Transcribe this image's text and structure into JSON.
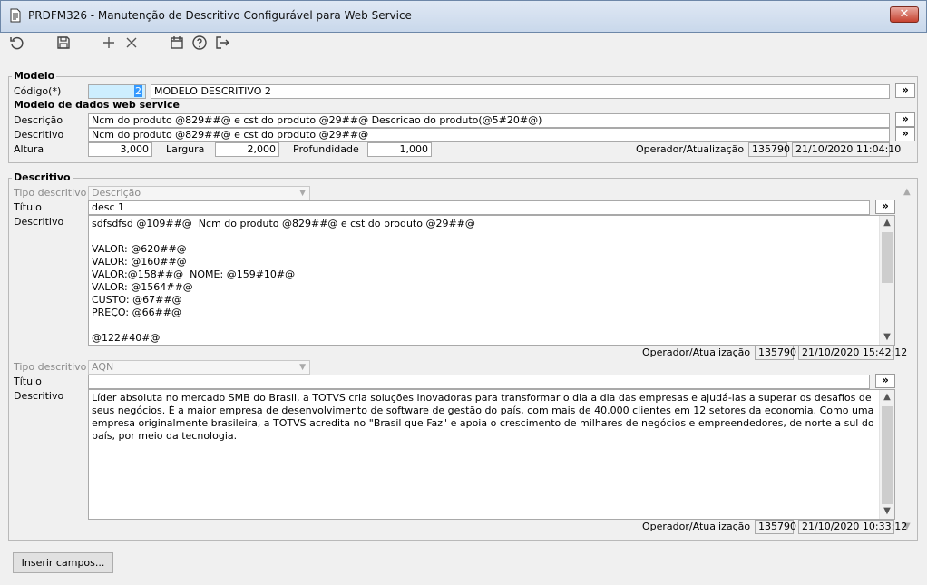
{
  "window": {
    "title": "PRDFM326 - Manutenção de Descritivo Configurável para Web Service",
    "close_label": "✕"
  },
  "toolbar": {
    "icons": [
      "refresh-icon",
      "save-icon",
      "add-icon",
      "delete-icon",
      "calendar-icon",
      "help-icon",
      "exit-icon"
    ]
  },
  "modelo": {
    "legend": "Modelo",
    "codigo_label": "Código(*)",
    "codigo_value": "2",
    "nome_value": "MODELO DESCRITIVO 2"
  },
  "web_service": {
    "legend": "Modelo de dados web service",
    "descricao_label": "Descrição",
    "descricao_value": "Ncm do produto @829##@ e cst do produto @29##@ Descricao do produto(@5#20#@)",
    "descritivo_label": "Descritivo",
    "descritivo_value": "Ncm do produto @829##@ e cst do produto @29##@",
    "altura_label": "Altura",
    "altura_value": "3,000",
    "largura_label": "Largura",
    "largura_value": "2,000",
    "profundidade_label": "Profundidade",
    "profundidade_value": "1,000",
    "operador_label": "Operador/Atualização",
    "operador_value": "135790",
    "data_value": "21/10/2020 11:04:10"
  },
  "descritivo": {
    "legend": "Descritivo",
    "items": [
      {
        "tipo_label": "Tipo descritivo",
        "tipo_value": "Descrição",
        "titulo_label": "Título",
        "titulo_value": "desc 1",
        "descritivo_label": "Descritivo",
        "text": "sdfsdfsd @109##@  Ncm do produto @829##@ e cst do produto @29##@\n\nVALOR: @620##@\nVALOR: @160##@\nVALOR:@158##@  NOME: @159#10#@\nVALOR: @1564##@\nCUSTO: @67##@\nPREÇO: @66##@\n\n@122#40#@",
        "operador_label": "Operador/Atualização",
        "operador_value": "135790",
        "data_value": "21/10/2020 15:42:12"
      },
      {
        "tipo_label": "Tipo descritivo",
        "tipo_value": "AQN",
        "titulo_label": "Título",
        "titulo_value": "",
        "descritivo_label": "Descritivo",
        "text": "Líder absoluta no mercado SMB do Brasil, a TOTVS cria soluções inovadoras para transformar o dia a dia das empresas e ajudá-las a superar os desafios de seus negócios. É a maior empresa de desenvolvimento de software de gestão do país, com mais de 40.000 clientes em 12 setores da economia. Como uma empresa originalmente brasileira, a TOTVS acredita no \"Brasil que Faz\" e apoia o crescimento de milhares de negócios e empreendedores, de norte a sul do país, por meio da tecnologia.",
        "operador_label": "Operador/Atualização",
        "operador_value": "135790",
        "data_value": "21/10/2020 10:33:12"
      }
    ]
  },
  "footer": {
    "insert_button": "Inserir campos..."
  },
  "symbols": {
    "more": "»"
  }
}
